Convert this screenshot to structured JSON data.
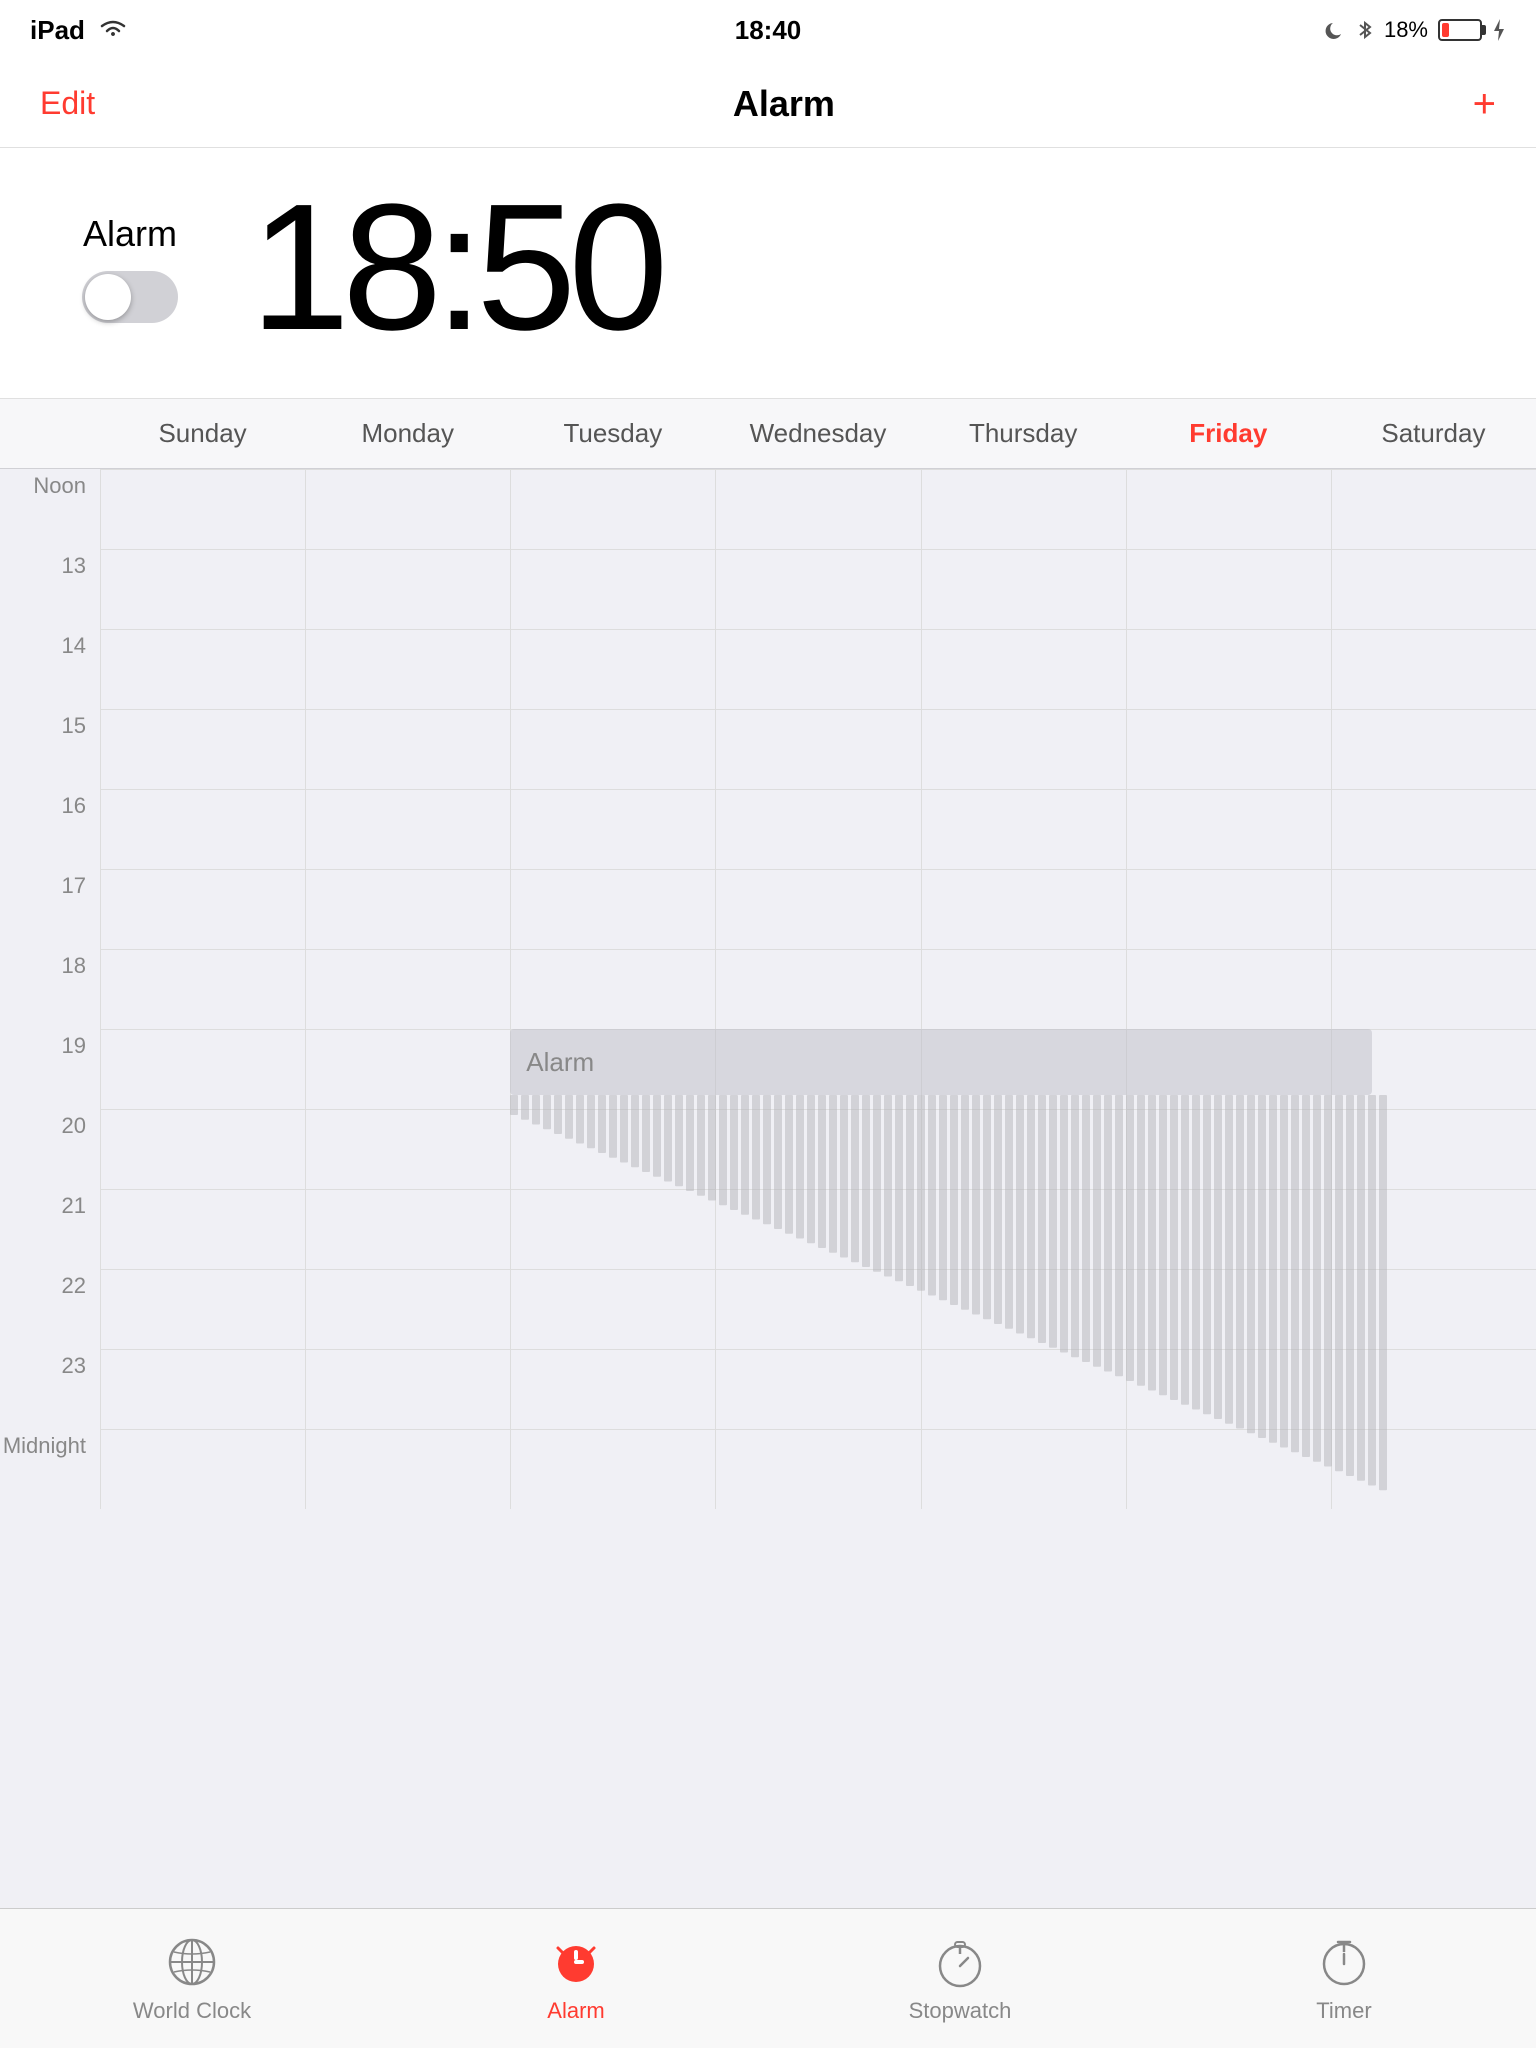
{
  "status": {
    "device": "iPad",
    "time": "18:40",
    "battery_percent": "18%",
    "signal": "WiFi"
  },
  "nav": {
    "edit_label": "Edit",
    "title": "Alarm",
    "add_icon": "+"
  },
  "alarm_card": {
    "label": "Alarm",
    "time": "18:50",
    "toggle_on": false
  },
  "calendar": {
    "days": [
      "Sunday",
      "Monday",
      "Tuesday",
      "Wednesday",
      "Thursday",
      "Friday",
      "Saturday"
    ],
    "active_day": "Friday",
    "time_labels": [
      "Noon",
      "13",
      "14",
      "15",
      "16",
      "17",
      "18",
      "19",
      "20",
      "21",
      "22",
      "23",
      "Midnight"
    ],
    "alarm_event_label": "Alarm"
  },
  "tabs": [
    {
      "id": "world-clock",
      "label": "World Clock",
      "active": false
    },
    {
      "id": "alarm",
      "label": "Alarm",
      "active": true
    },
    {
      "id": "stopwatch",
      "label": "Stopwatch",
      "active": false
    },
    {
      "id": "timer",
      "label": "Timer",
      "active": false
    }
  ]
}
